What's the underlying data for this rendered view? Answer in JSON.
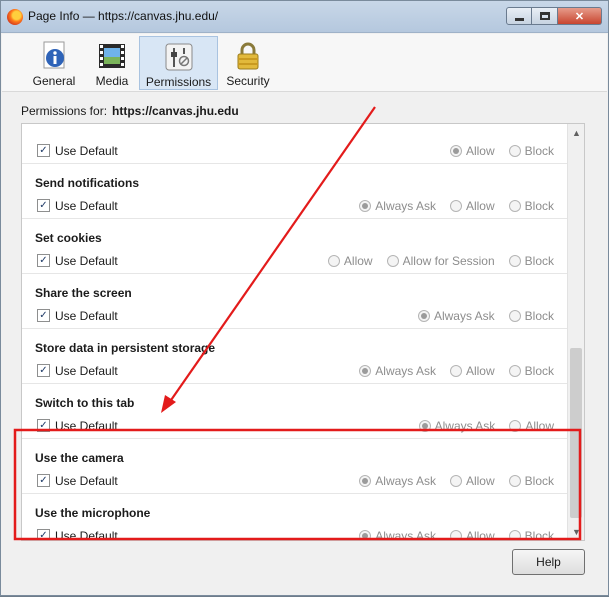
{
  "window": {
    "title": "Page Info — https://canvas.jhu.edu/"
  },
  "tabs": [
    {
      "label": "General",
      "icon": "info-icon"
    },
    {
      "label": "Media",
      "icon": "media-icon"
    },
    {
      "label": "Permissions",
      "icon": "permissions-icon",
      "selected": true
    },
    {
      "label": "Security",
      "icon": "lock-icon"
    }
  ],
  "permissions_for": {
    "label": "Permissions for:",
    "site": "https://canvas.jhu.edu"
  },
  "rows": [
    {
      "title": "",
      "checkbox_label": "Use Default",
      "checked": true,
      "options": [
        {
          "label": "Allow",
          "selected": true
        },
        {
          "label": "Block",
          "selected": false
        }
      ]
    },
    {
      "title": "Send notifications",
      "checkbox_label": "Use Default",
      "checked": true,
      "options": [
        {
          "label": "Always Ask",
          "selected": true
        },
        {
          "label": "Allow",
          "selected": false
        },
        {
          "label": "Block",
          "selected": false
        }
      ]
    },
    {
      "title": "Set cookies",
      "checkbox_label": "Use Default",
      "checked": true,
      "options": [
        {
          "label": "Allow",
          "selected": false
        },
        {
          "label": "Allow for Session",
          "selected": false
        },
        {
          "label": "Block",
          "selected": false
        }
      ]
    },
    {
      "title": "Share the screen",
      "checkbox_label": "Use Default",
      "checked": true,
      "options": [
        {
          "label": "Always Ask",
          "selected": true
        },
        {
          "label": "Block",
          "selected": false
        }
      ]
    },
    {
      "title": "Store data in persistent storage",
      "checkbox_label": "Use Default",
      "checked": true,
      "options": [
        {
          "label": "Always Ask",
          "selected": true
        },
        {
          "label": "Allow",
          "selected": false
        },
        {
          "label": "Block",
          "selected": false
        }
      ]
    },
    {
      "title": "Switch to this tab",
      "checkbox_label": "Use Default",
      "checked": true,
      "options": [
        {
          "label": "Always Ask",
          "selected": true
        },
        {
          "label": "Allow",
          "selected": false
        }
      ]
    },
    {
      "title": "Use the camera",
      "checkbox_label": "Use Default",
      "checked": true,
      "options": [
        {
          "label": "Always Ask",
          "selected": true
        },
        {
          "label": "Allow",
          "selected": false
        },
        {
          "label": "Block",
          "selected": false
        }
      ]
    },
    {
      "title": "Use the microphone",
      "checkbox_label": "Use Default",
      "checked": true,
      "options": [
        {
          "label": "Always Ask",
          "selected": true
        },
        {
          "label": "Allow",
          "selected": false
        },
        {
          "label": "Block",
          "selected": false
        }
      ]
    }
  ],
  "help_button": {
    "label": "Help"
  },
  "colors": {
    "annotation": "#e31b1b",
    "selected_tab": "#d8e6f5"
  }
}
